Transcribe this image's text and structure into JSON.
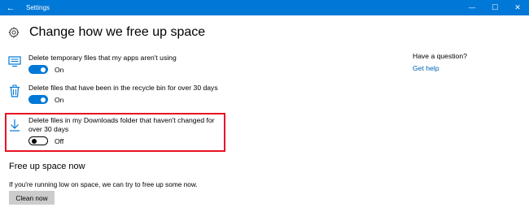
{
  "window": {
    "title": "Settings",
    "back_glyph": "←",
    "minimize_glyph": "—",
    "maximize_glyph": "☐",
    "close_glyph": "✕",
    "accent": "#0078d7"
  },
  "page": {
    "title": "Change how we free up space",
    "icon": "gear-icon"
  },
  "settings": [
    {
      "icon": "monitor-icon",
      "label": "Delete temporary files that my apps aren't using",
      "state_text": "On",
      "on": true
    },
    {
      "icon": "recycle-bin-icon",
      "label": "Delete files that have been in the recycle bin for over 30 days",
      "state_text": "On",
      "on": true
    },
    {
      "icon": "download-icon",
      "label_line1": "Delete files in my Downloads folder that haven't changed for",
      "label_line2": "over 30 days",
      "state_text": "Off",
      "on": false,
      "highlight_color": "#e81123"
    }
  ],
  "free_up": {
    "heading": "Free up space now",
    "description": "If you're running low on space, we can try to free up some now.",
    "button_label": "Clean now"
  },
  "sidebar": {
    "question": "Have a question?",
    "help_link": "Get help",
    "link_color": "#0063b1"
  }
}
